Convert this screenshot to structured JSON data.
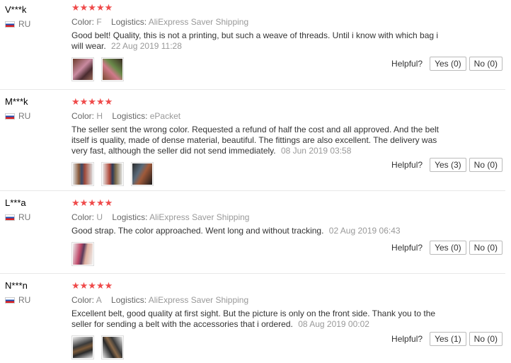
{
  "reviews": [
    {
      "user": "V***k",
      "country": "RU",
      "stars": "★★★★★",
      "color_label": "Color:",
      "color": "F",
      "logistics_label": "Logistics:",
      "logistics": "AliExpress Saver Shipping",
      "text": "Good belt! Quality, this is not a printing, but such a weave of threads. Until i know with which bag i will wear.",
      "date": "22 Aug 2019 11:28",
      "helpful_label": "Helpful?",
      "yes": "Yes (0)",
      "no": "No (0)",
      "photos": 2
    },
    {
      "user": "M***k",
      "country": "RU",
      "stars": "★★★★★",
      "color_label": "Color:",
      "color": "H",
      "logistics_label": "Logistics:",
      "logistics": "ePacket",
      "text": "The seller sent the wrong color. Requested a refund of half the cost and all approved. And the belt itself is quality, made of dense material, beautiful. The fittings are also excellent. The delivery was very fast, although the seller did not send immediately.",
      "date": "08 Jun 2019 03:58",
      "helpful_label": "Helpful?",
      "yes": "Yes (3)",
      "no": "No (0)",
      "photos": 3
    },
    {
      "user": "L***a",
      "country": "RU",
      "stars": "★★★★★",
      "color_label": "Color:",
      "color": "U",
      "logistics_label": "Logistics:",
      "logistics": "AliExpress Saver Shipping",
      "text": "Good strap. The color approached. Went long and without tracking.",
      "date": "02 Aug 2019 06:43",
      "helpful_label": "Helpful?",
      "yes": "Yes (0)",
      "no": "No (0)",
      "photos": 1
    },
    {
      "user": "N***n",
      "country": "RU",
      "stars": "★★★★★",
      "color_label": "Color:",
      "color": "A",
      "logistics_label": "Logistics:",
      "logistics": "AliExpress Saver Shipping",
      "text": "Excellent belt, good quality at first sight. But the picture is only on the front side. Thank you to the seller for sending a belt with the accessories that i ordered.",
      "date": "08 Aug 2019 00:02",
      "helpful_label": "Helpful?",
      "yes": "Yes (1)",
      "no": "No (0)",
      "photos": 2
    }
  ]
}
